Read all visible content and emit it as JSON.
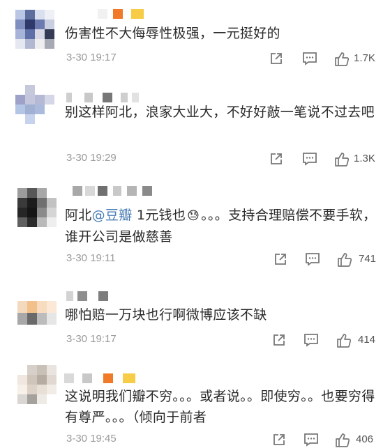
{
  "comments": [
    {
      "text": "伤害性不大侮辱性极强，一元挺好的",
      "time": "3-30 19:17",
      "likes": "1.7K"
    },
    {
      "text": "别这样阿北，浪家大业大，不好好敲一笔说不过去吧",
      "time": "3-30 19:29",
      "likes": "1.3K"
    },
    {
      "text_before": "阿北",
      "mention": "@豆瓣",
      "text_after": " 1元钱也",
      "emoji": "😓",
      "text_end": "。。。支持合理赔偿不要手软，谁开公司是做慈善",
      "time": "3-30 19:11",
      "likes": "741"
    },
    {
      "text": "哪怕赔一万块也行啊微博应该不缺",
      "time": "3-30 19:17",
      "likes": "414"
    },
    {
      "text": "这说明我们瓣不穷。。。或者说。。即使穷。。也要穷得有尊严。。。（倾向于前者",
      "time": "3-30 19:45",
      "likes": "406"
    }
  ],
  "colors": {
    "text": "#2a2a2a",
    "meta": "#9a9a9a",
    "mention": "#4a7db5",
    "icon": "#777777"
  },
  "icons": {
    "share": "share-icon",
    "comment": "comment-icon",
    "like": "thumbs-up-icon"
  }
}
